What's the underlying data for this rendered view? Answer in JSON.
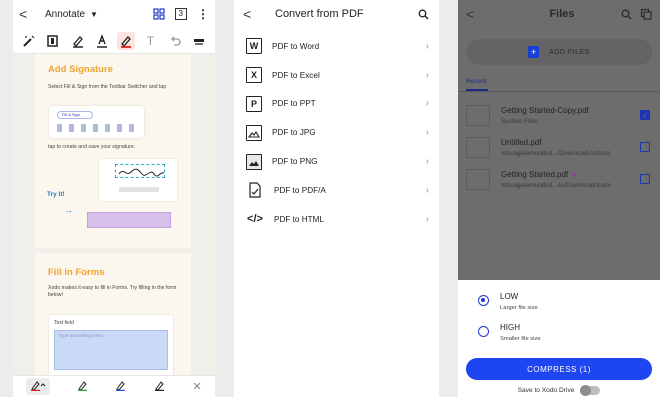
{
  "annotate": {
    "back_glyph": "<",
    "title": "Annotate",
    "title_caret": "▼",
    "page_counter": "3",
    "menu_glyph": "⋮",
    "tools": [
      "pen-mode",
      "outline",
      "highlighter",
      "text-underline",
      "pen-active",
      "text",
      "undo",
      "redo"
    ],
    "text_tool_glyph": "T",
    "doc": {
      "signature_heading": "Add Signature",
      "signature_text": "Select Fill & Sign from the Toolbar Switcher and tap",
      "signature_text2": "tap to create and save your signature.",
      "fill_sign_chip": "Fill & Sign",
      "try_it": "Try It!",
      "forms_heading": "Fill in Forms",
      "forms_text": "Xodo makes it easy to fill in Forms. Try filling in the form below!",
      "text_field_label": "Text field",
      "text_field_placeholder": "Type something here..."
    },
    "bottom": {
      "caret": "^",
      "close_glyph": "✕"
    }
  },
  "convert": {
    "back_glyph": "<",
    "title": "Convert from PDF",
    "items": [
      {
        "icon_text": "W",
        "label": "PDF to Word"
      },
      {
        "icon_text": "X",
        "label": "PDF to Excel"
      },
      {
        "icon_text": "P",
        "label": "PDF to PPT"
      },
      {
        "icon_text": "",
        "label": "PDF to JPG"
      },
      {
        "icon_text": "",
        "label": "PDF to PNG"
      },
      {
        "icon_text": "",
        "label": "PDF to PDF/A"
      },
      {
        "icon_text": "</>",
        "label": "PDF to HTML"
      }
    ],
    "chevron": "›"
  },
  "files": {
    "back_glyph": "<",
    "title": "Files",
    "add_files": "ADD FILES",
    "recent_tab": "Recent",
    "rows": [
      {
        "name": "Getting Started-Copy.pdf",
        "path": "System Files",
        "checked": true,
        "favorite": false
      },
      {
        "name": "Untitled.pdf",
        "path": "/storage/emulated.../Download/Actions",
        "checked": false,
        "favorite": false
      },
      {
        "name": "Getting Started.pdf",
        "path": "/storage/emulated...ex/Download/Xodo",
        "checked": false,
        "favorite": true
      }
    ],
    "heart_glyph": "♥",
    "check_glyph": "✓",
    "options": [
      {
        "title": "LOW",
        "sub": "Larger file size",
        "selected": true
      },
      {
        "title": "HIGH",
        "sub": "Smaller file size",
        "selected": false
      }
    ],
    "compress_button": "COMPRESS (1)",
    "drive_label": "Save to Xodo Drive",
    "drive_toggle_on": false
  },
  "colors": {
    "accent_blue": "#1d45f0",
    "orange_heading": "#f0a233",
    "overlay": "#6d6d6d"
  }
}
